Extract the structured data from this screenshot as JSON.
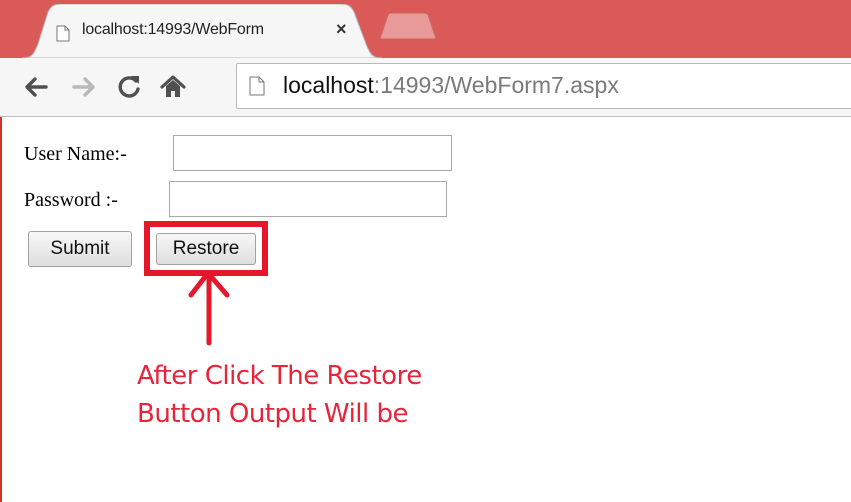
{
  "browser": {
    "tab_title": "localhost:14993/WebForm",
    "tab_close": "×",
    "url_host": "localhost",
    "url_rest": ":14993/WebForm7.aspx"
  },
  "form": {
    "username_label": "User Name:-",
    "username_value": "",
    "password_label": "Password :-",
    "password_value": "",
    "submit_label": "Submit",
    "restore_label": "Restore"
  },
  "annotation": {
    "line1": "After Click The Restore",
    "line2": "Button Output Will be"
  },
  "colors": {
    "tabstrip": "#d95a57",
    "highlight": "#e4182a",
    "annotation": "#e8243a"
  },
  "icons": {
    "back": "back-arrow-icon",
    "forward": "forward-arrow-icon",
    "reload": "reload-icon",
    "home": "home-icon",
    "page": "page-icon",
    "arrow": "up-arrow-icon"
  }
}
